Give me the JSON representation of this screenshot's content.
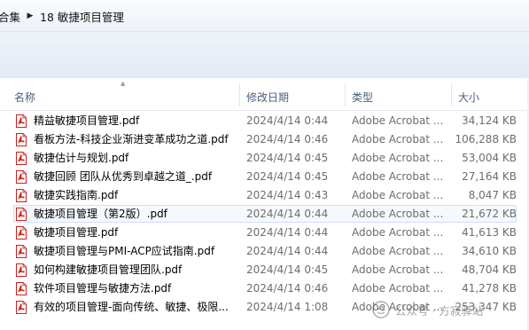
{
  "address": {
    "crumbs": [
      "合集",
      "18 敏捷项目管理"
    ]
  },
  "columns": {
    "name": "名称",
    "date": "修改日期",
    "type": "类型",
    "size": "大小"
  },
  "files": [
    {
      "name": "精益敏捷项目管理.pdf",
      "date": "2024/4/14 0:44",
      "type": "Adobe Acrobat ...",
      "size": "34,124 KB"
    },
    {
      "name": "看板方法-科技企业渐进变革成功之道.pdf",
      "date": "2024/4/14 0:46",
      "type": "Adobe Acrobat ...",
      "size": "106,288 KB"
    },
    {
      "name": "敏捷估计与规划.pdf",
      "date": "2024/4/14 0:45",
      "type": "Adobe Acrobat ...",
      "size": "53,004 KB"
    },
    {
      "name": "敏捷回顾  团队从优秀到卓越之道_.pdf",
      "date": "2024/4/14 0:45",
      "type": "Adobe Acrobat ...",
      "size": "27,164 KB"
    },
    {
      "name": "敏捷实践指南.pdf",
      "date": "2024/4/14 0:43",
      "type": "Adobe Acrobat ...",
      "size": "8,047 KB"
    },
    {
      "name": "敏捷项目管理（第2版）.pdf",
      "date": "2024/4/14 0:44",
      "type": "Adobe Acrobat ...",
      "size": "21,672 KB"
    },
    {
      "name": "敏捷项目管理.pdf",
      "date": "2024/4/14 0:44",
      "type": "Adobe Acrobat ...",
      "size": "41,613 KB"
    },
    {
      "name": "敏捷项目管理与PMI-ACP应试指南.pdf",
      "date": "2024/4/14 0:44",
      "type": "Adobe Acrobat ...",
      "size": "34,610 KB"
    },
    {
      "name": "如何构建敏捷项目管理团队.pdf",
      "date": "2024/4/14 0:45",
      "type": "Adobe Acrobat ...",
      "size": "48,704 KB"
    },
    {
      "name": "软件项目管理与敏捷方法.pdf",
      "date": "2024/4/14 0:46",
      "type": "Adobe Acrobat ...",
      "size": "41,278 KB"
    },
    {
      "name": "有效的项目管理-面向传统、敏捷、极限...",
      "date": "2024/4/14 1:08",
      "type": "Adobe Acrobat ...",
      "size": "253,347 KB"
    }
  ],
  "selected_index": 5,
  "watermark": {
    "text": "公众号 · 方寂驿站"
  },
  "colors": {
    "pdf_red": "#c8211c",
    "selection_border": "#cfe0f4",
    "selection_fill": "#f5f9fe",
    "header_text": "#4c607a"
  }
}
